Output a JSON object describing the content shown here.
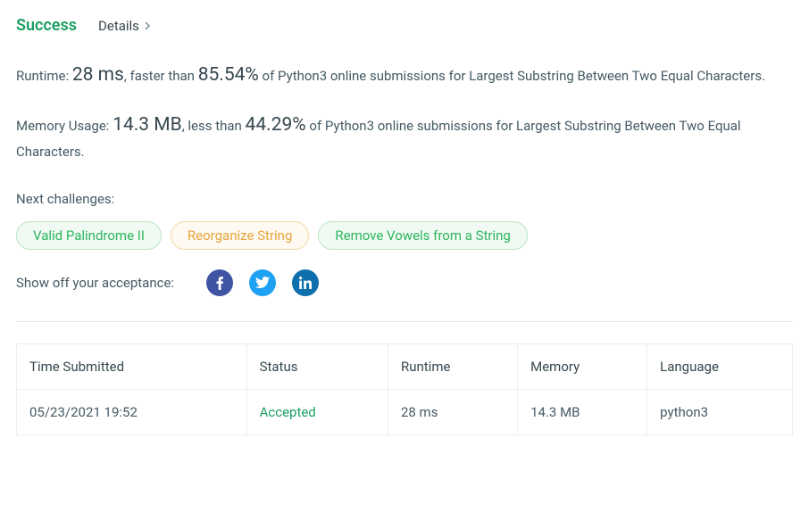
{
  "header": {
    "status": "Success",
    "details_label": "Details"
  },
  "runtime": {
    "prefix": "Runtime: ",
    "value": "28 ms",
    "mid": ", faster than ",
    "percent": "85.54%",
    "suffix": " of Python3 online submissions for Largest Substring Between Two Equal Characters."
  },
  "memory": {
    "prefix": "Memory Usage: ",
    "value": "14.3 MB",
    "mid": ", less than ",
    "percent": "44.29%",
    "suffix": " of Python3 online submissions for Largest Substring Between Two Equal Characters."
  },
  "next_label": "Next challenges:",
  "challenges": {
    "c0": "Valid Palindrome II",
    "c1": "Reorganize String",
    "c2": "Remove Vowels from a String"
  },
  "show_off": "Show off your acceptance:",
  "table": {
    "headers": {
      "time": "Time Submitted",
      "status": "Status",
      "runtime": "Runtime",
      "memory": "Memory",
      "language": "Language"
    },
    "row": {
      "time": "05/23/2021 19:52",
      "status": "Accepted",
      "runtime": "28 ms",
      "memory": "14.3 MB",
      "language": "python3"
    }
  }
}
